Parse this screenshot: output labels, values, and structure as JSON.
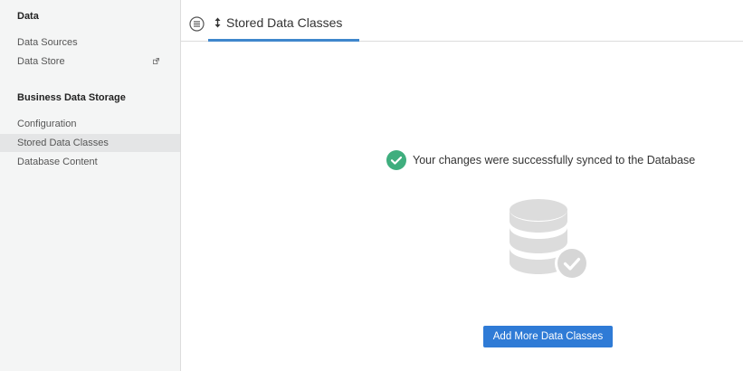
{
  "sidebar": {
    "sections": [
      {
        "title": "Data",
        "items": [
          {
            "label": "Data Sources"
          },
          {
            "label": "Data Store",
            "icon": "external-link-icon"
          }
        ]
      },
      {
        "title": "Business Data Storage",
        "items": [
          {
            "label": "Configuration"
          },
          {
            "label": "Stored Data Classes",
            "active": true
          },
          {
            "label": "Database Content"
          }
        ]
      }
    ]
  },
  "header": {
    "menu_icon": "menu-lines-icon",
    "tab": {
      "label": "Stored Data Classes",
      "icon": "sort-arrows-icon"
    }
  },
  "main": {
    "success_message": "Your changes were successfully synced to the Database",
    "success_icon": "check-circle-icon",
    "illustration_icon": "database-check-icon",
    "button_label": "Add More Data Classes"
  },
  "colors": {
    "accent": "#3f87cc",
    "button": "#2f7bd6",
    "success": "#3fae7e",
    "sidebar_bg": "#f4f5f5",
    "active_item_bg": "#e4e5e6",
    "illustration": "#dcdcdc"
  }
}
